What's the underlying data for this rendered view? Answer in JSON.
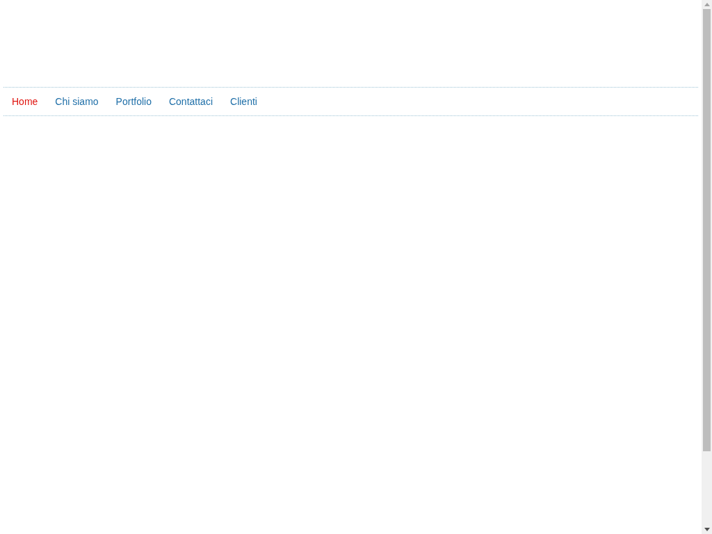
{
  "nav": {
    "items": [
      {
        "label": "Home",
        "selected": true
      },
      {
        "label": "Chi siamo",
        "selected": false
      },
      {
        "label": "Portfolio",
        "selected": false
      },
      {
        "label": "Contattaci",
        "selected": false
      },
      {
        "label": "Clienti",
        "selected": false
      }
    ]
  }
}
